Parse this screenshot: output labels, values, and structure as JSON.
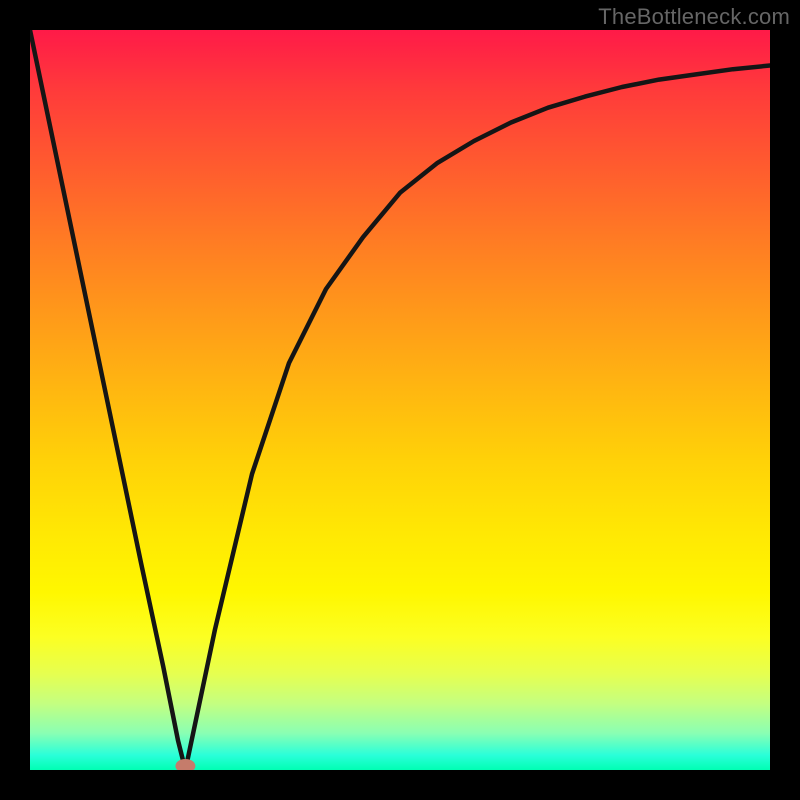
{
  "attribution": "TheBottleneck.com",
  "colors": {
    "frame": "#000000",
    "curve": "#151515",
    "marker": "#c57c6b",
    "attribution": "#666666",
    "gradient_top": "#ff1a48",
    "gradient_bottom": "#00ffb3"
  },
  "chart_data": {
    "type": "line",
    "title": "",
    "xlabel": "",
    "ylabel": "",
    "xlim": [
      0,
      100
    ],
    "ylim": [
      0,
      100
    ],
    "grid": false,
    "legend": false,
    "series": [
      {
        "name": "bottleneck-curve",
        "x": [
          0,
          5,
          10,
          15,
          18,
          20,
          21,
          25,
          30,
          35,
          40,
          45,
          50,
          55,
          60,
          65,
          70,
          75,
          80,
          85,
          90,
          95,
          100
        ],
        "y": [
          100,
          76,
          52,
          28,
          14,
          4,
          0,
          19,
          40,
          55,
          65,
          72,
          78,
          82,
          85,
          87.5,
          89.5,
          91,
          92.3,
          93.3,
          94,
          94.7,
          95.2
        ]
      }
    ],
    "annotations": [
      {
        "name": "minimum-marker",
        "x": 21,
        "y": 0,
        "shape": "ellipse"
      }
    ],
    "background": {
      "type": "vertical-gradient",
      "note": "red at top (high y) through orange/yellow to green at bottom (y=0)"
    }
  }
}
